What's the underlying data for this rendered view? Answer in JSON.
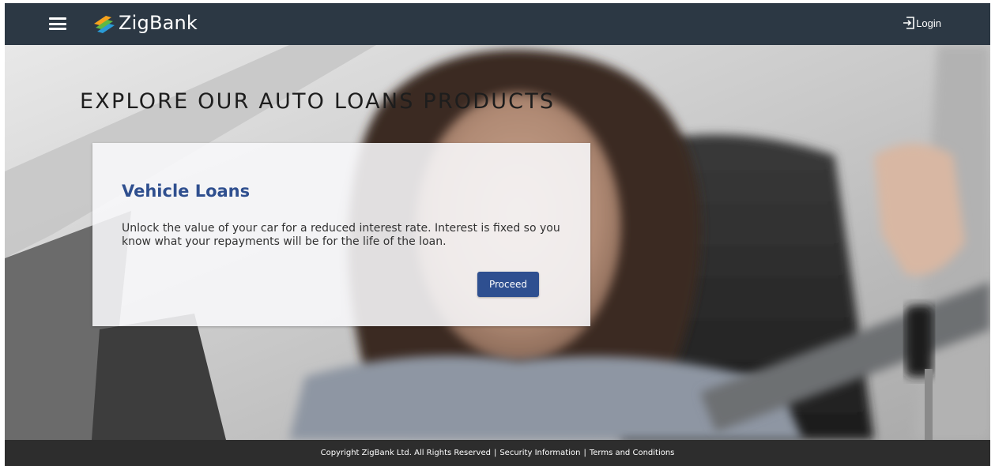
{
  "header": {
    "brand": "ZigBank",
    "login_label": "Login"
  },
  "hero": {
    "title": "EXPLORE OUR AUTO LOANS PRODUCTS"
  },
  "card": {
    "title": "Vehicle Loans",
    "description": "Unlock the value of your car for a reduced interest rate. Interest is fixed so you know what your repayments will be for the life of the loan.",
    "button_label": "Proceed"
  },
  "footer": {
    "copyright": "Copyright ZigBank Ltd. All Rights Reserved",
    "security": "Security Information",
    "terms": "Terms and Conditions",
    "separator": "|"
  },
  "colors": {
    "header_bg": "#2c3844",
    "accent": "#2e4f90",
    "footer_bg": "#2d2d2d"
  },
  "icons": {
    "menu": "hamburger-menu-icon",
    "logo": "zigbank-logo-icon",
    "login": "login-arrow-icon"
  }
}
